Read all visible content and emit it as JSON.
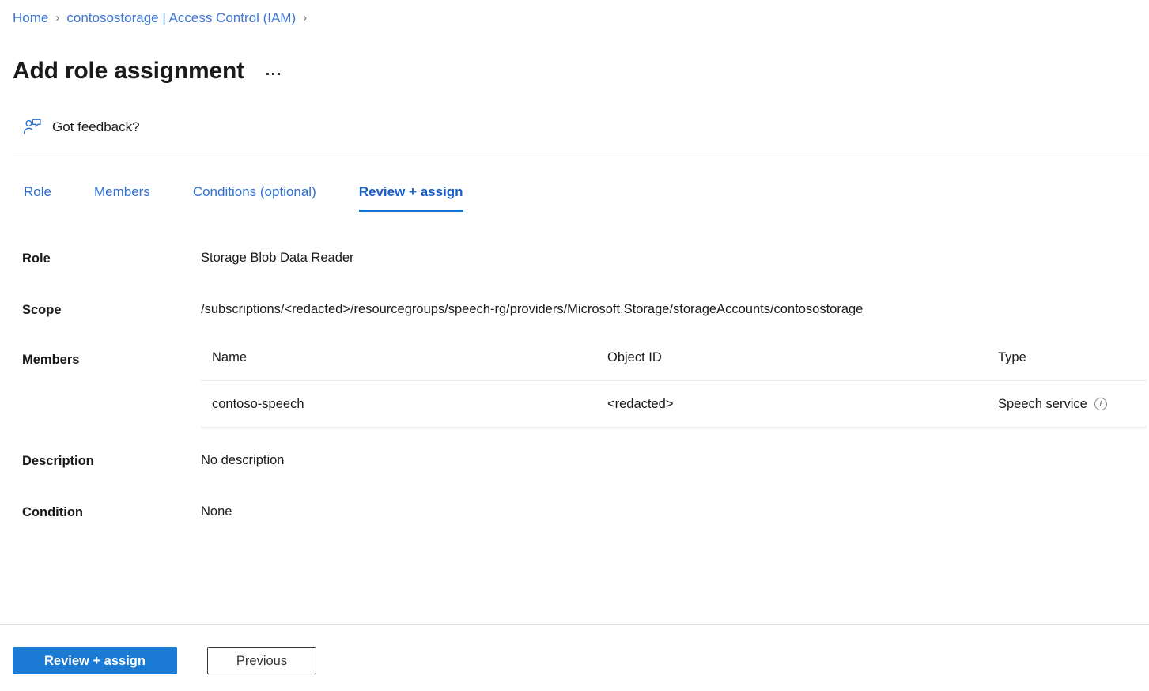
{
  "breadcrumb": {
    "items": [
      {
        "label": "Home",
        "type": "link"
      },
      {
        "label": "contosostorage | Access Control (IAM)",
        "type": "link"
      }
    ],
    "separator": "›"
  },
  "header": {
    "title": "Add role assignment",
    "more_menu_label": "…"
  },
  "feedback": {
    "label": "Got feedback?",
    "icon": "person-feedback-icon"
  },
  "tabs": [
    {
      "label": "Role",
      "active": false
    },
    {
      "label": "Members",
      "active": false
    },
    {
      "label": "Conditions (optional)",
      "active": false
    },
    {
      "label": "Review + assign",
      "active": true
    }
  ],
  "details": {
    "role_label": "Role",
    "role_value": "Storage Blob Data Reader",
    "scope_label": "Scope",
    "scope_value": "/subscriptions/<redacted>/resourcegroups/speech-rg/providers/Microsoft.Storage/storageAccounts/contosostorage",
    "members_label": "Members",
    "description_label": "Description",
    "description_value": "No description",
    "condition_label": "Condition",
    "condition_value": "None"
  },
  "members_table": {
    "columns": [
      "Name",
      "Object ID",
      "Type"
    ],
    "rows": [
      {
        "name": "contoso-speech",
        "object_id": "<redacted>",
        "type": "Speech service",
        "type_info_icon": "info-icon"
      }
    ]
  },
  "footer": {
    "primary_button": "Review + assign",
    "secondary_button": "Previous"
  },
  "colors": {
    "accent_blue": "#1b7ad4",
    "link_blue": "#3b76d8",
    "tab_active_blue": "#165fc9",
    "tab_underline": "#1570d8",
    "text": "#1b1a19",
    "divider": "#e1e1e1"
  }
}
